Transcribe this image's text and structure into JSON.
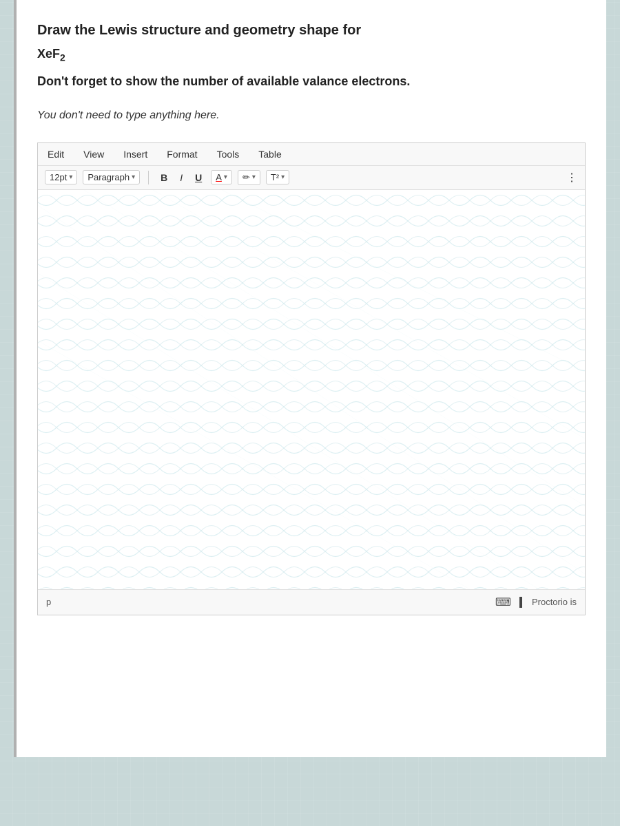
{
  "page": {
    "background_color": "#c8d8d8"
  },
  "question": {
    "title_line1": "Draw the Lewis structure and geometry shape for",
    "formula": "XeF",
    "formula_subscript": "2",
    "subtitle": "Don't forget to show the number of available valance electrons.",
    "note": "You don't need to type anything here."
  },
  "editor": {
    "menu": {
      "edit_label": "Edit",
      "view_label": "View",
      "insert_label": "Insert",
      "format_label": "Format",
      "tools_label": "Tools",
      "table_label": "Table"
    },
    "toolbar": {
      "font_size_label": "12pt",
      "paragraph_label": "Paragraph",
      "bold_label": "B",
      "italic_label": "I",
      "underline_label": "U",
      "font_color_label": "A",
      "highlight_label": "✏",
      "superscript_label": "T²",
      "more_label": "⋮"
    },
    "statusbar": {
      "paragraph_indicator": "p",
      "proctorio_label": "Proctorio is"
    }
  }
}
